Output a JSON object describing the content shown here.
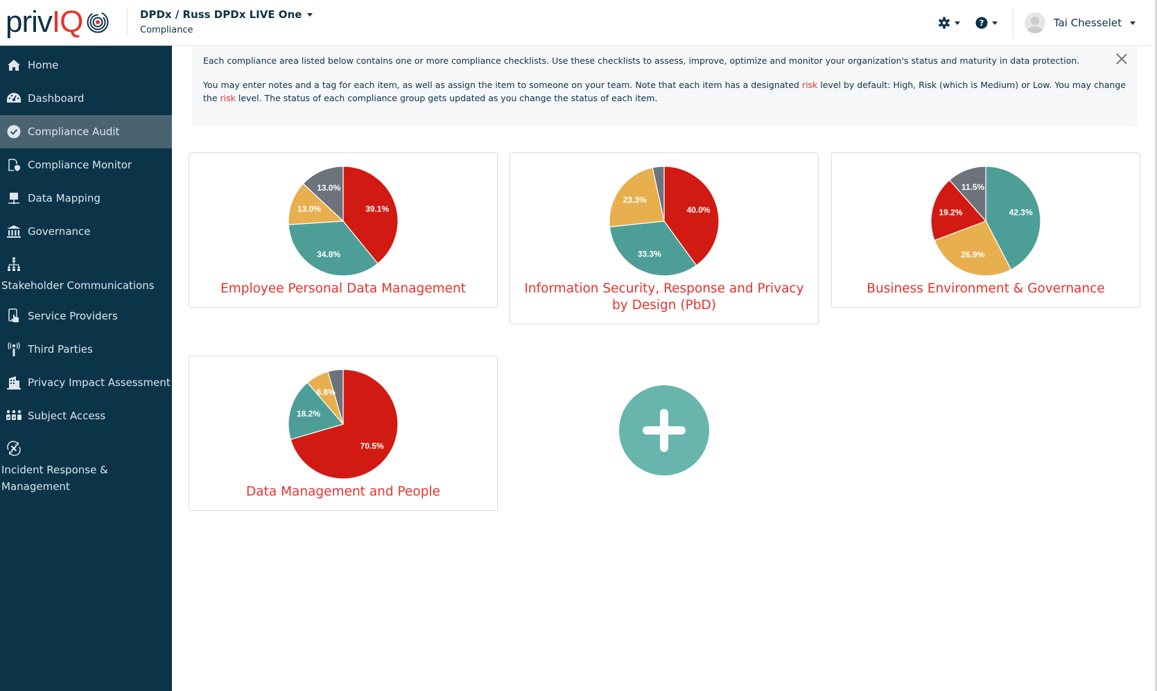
{
  "header": {
    "logo_text_a": "priv",
    "logo_text_b": "IQ",
    "org_title": "DPDx / Russ DPDx LIVE One",
    "org_subtitle": "Compliance",
    "settings_icon": "gear-icon",
    "help_icon": "question-circle-icon",
    "user_name": "Tai Chesselet"
  },
  "sidebar": {
    "items": [
      {
        "label": "Home",
        "icon": "home-icon"
      },
      {
        "label": "Dashboard",
        "icon": "tachometer-icon"
      },
      {
        "label": "Compliance Audit",
        "icon": "check-circle-icon",
        "active": true
      },
      {
        "label": "Compliance Monitor",
        "icon": "document-shield-icon"
      },
      {
        "label": "Data Mapping",
        "icon": "folder-network-icon"
      },
      {
        "label": "Governance",
        "icon": "bank-icon"
      },
      {
        "label": "Stakeholder Communications",
        "icon": "org-chart-icon"
      },
      {
        "label": "Service Providers",
        "icon": "tablet-hand-icon"
      },
      {
        "label": "Third Parties",
        "icon": "broadcast-tower-icon"
      },
      {
        "label": "Privacy Impact Assessment",
        "icon": "building-icon"
      },
      {
        "label": "Subject Access",
        "icon": "people-check-icon"
      },
      {
        "label": "Incident Response & Management",
        "icon": "cycle-x-icon"
      }
    ]
  },
  "banner": {
    "line1": "Each compliance area listed below contains one or more compliance checklists. Use these checklists to assess, improve, optimize and monitor your organization's status and maturity in data protection.",
    "line2_a": "You may enter notes and a tag for each item, as well as assign the item to someone on your team. Note that each item has a designated ",
    "risk_word": "risk",
    "line2_b": " level by default: High, Risk (which is Medium) or Low. You may change the ",
    "line2_c": " level. The status of each compliance group gets updated as you change the status of each item."
  },
  "colors": {
    "red": "#d11a12",
    "teal": "#4e9e98",
    "yellow": "#e8af4f",
    "gray": "#6c737c",
    "accent_red": "#e8312a",
    "sidebar_bg": "#0b3449",
    "add_button": "#68b5ae"
  },
  "chart_data": [
    {
      "type": "pie",
      "title": "Employee Personal Data Management",
      "labels": [
        "Red",
        "Teal",
        "Yellow",
        "Gray"
      ],
      "values": [
        39.1,
        34.8,
        13.0,
        13.0
      ],
      "display_labels": [
        "39.1%",
        "34.8%",
        "13.0%",
        "13.0%"
      ],
      "start": "top",
      "direction": "clockwise"
    },
    {
      "type": "pie",
      "title": "Information Security, Response and Privacy by Design (PbD)",
      "labels": [
        "Red",
        "Teal",
        "Yellow",
        "Gray"
      ],
      "values": [
        40.0,
        33.3,
        23.3,
        3.4
      ],
      "display_labels": [
        "40.0%",
        "33.3%",
        "23.3%",
        ""
      ],
      "start": "top",
      "direction": "clockwise"
    },
    {
      "type": "pie",
      "title": "Business Environment & Governance",
      "labels": [
        "Teal",
        "Yellow",
        "Red",
        "Gray"
      ],
      "values": [
        42.3,
        26.9,
        19.2,
        11.5
      ],
      "display_labels": [
        "42.3%",
        "26.9%",
        "19.2%",
        "11.5%"
      ],
      "start": "top",
      "direction": "clockwise"
    },
    {
      "type": "pie",
      "title": "Data Management and People",
      "labels": [
        "Red",
        "Teal",
        "Yellow",
        "Gray"
      ],
      "values": [
        70.5,
        18.2,
        6.8,
        4.5
      ],
      "display_labels": [
        "70.5%",
        "18.2%",
        "6.8%",
        ""
      ],
      "start": "top",
      "direction": "clockwise"
    }
  ],
  "add_button": {
    "icon": "plus-icon",
    "label": "Add compliance area"
  }
}
